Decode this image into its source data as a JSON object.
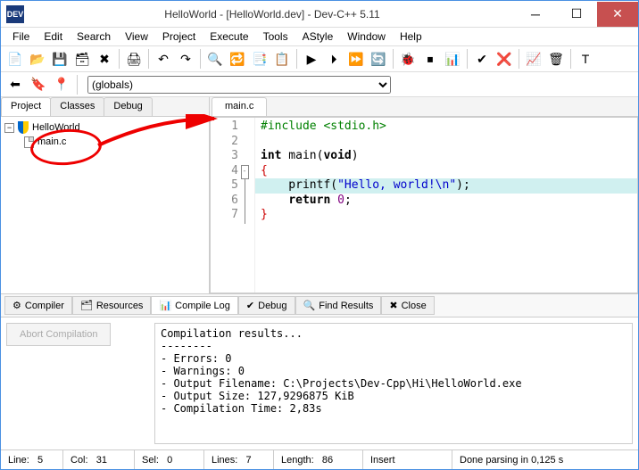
{
  "window": {
    "title": "HelloWorld - [HelloWorld.dev] - Dev-C++ 5.11"
  },
  "menu": [
    "File",
    "Edit",
    "Search",
    "View",
    "Project",
    "Execute",
    "Tools",
    "AStyle",
    "Window",
    "Help"
  ],
  "globals_selector": "(globals)",
  "left_tabs": [
    "Project",
    "Classes",
    "Debug"
  ],
  "project": {
    "name": "HelloWorld",
    "file": "main.c"
  },
  "editor_tab": "main.c",
  "code": {
    "lines": [
      {
        "n": 1,
        "html": "<span class='pp'>#include &lt;stdio.h&gt;</span>"
      },
      {
        "n": 2,
        "html": ""
      },
      {
        "n": 3,
        "html": "<span class='kw'>int</span> main(<span class='kw'>void</span>)"
      },
      {
        "n": 4,
        "html": "<span class='br'>{</span>",
        "fold": "-"
      },
      {
        "n": 5,
        "html": "    printf(<span class='str'>\"Hello, world!\\n\"</span>);",
        "hl": true
      },
      {
        "n": 6,
        "html": "    <span class='kw'>return</span> <span class='num'>0</span>;"
      },
      {
        "n": 7,
        "html": "<span class='br'>}</span>"
      }
    ]
  },
  "bottom_tabs": [
    {
      "label": "Compiler",
      "icon": "⚙"
    },
    {
      "label": "Resources",
      "icon": "🗂"
    },
    {
      "label": "Compile Log",
      "icon": "📊",
      "active": true
    },
    {
      "label": "Debug",
      "icon": "✔"
    },
    {
      "label": "Find Results",
      "icon": "🔍"
    },
    {
      "label": "Close",
      "icon": "✖"
    }
  ],
  "abort_label": "Abort Compilation",
  "compile_output": "Compilation results...\n--------\n- Errors: 0\n- Warnings: 0\n- Output Filename: C:\\Projects\\Dev-Cpp\\Hi\\HelloWorld.exe\n- Output Size: 127,9296875 KiB\n- Compilation Time: 2,83s",
  "status": {
    "line_label": "Line:",
    "line": "5",
    "col_label": "Col:",
    "col": "31",
    "sel_label": "Sel:",
    "sel": "0",
    "lines_label": "Lines:",
    "lines": "7",
    "length_label": "Length:",
    "length": "86",
    "mode": "Insert",
    "parse": "Done parsing in 0,125 s"
  },
  "chart_data": null
}
